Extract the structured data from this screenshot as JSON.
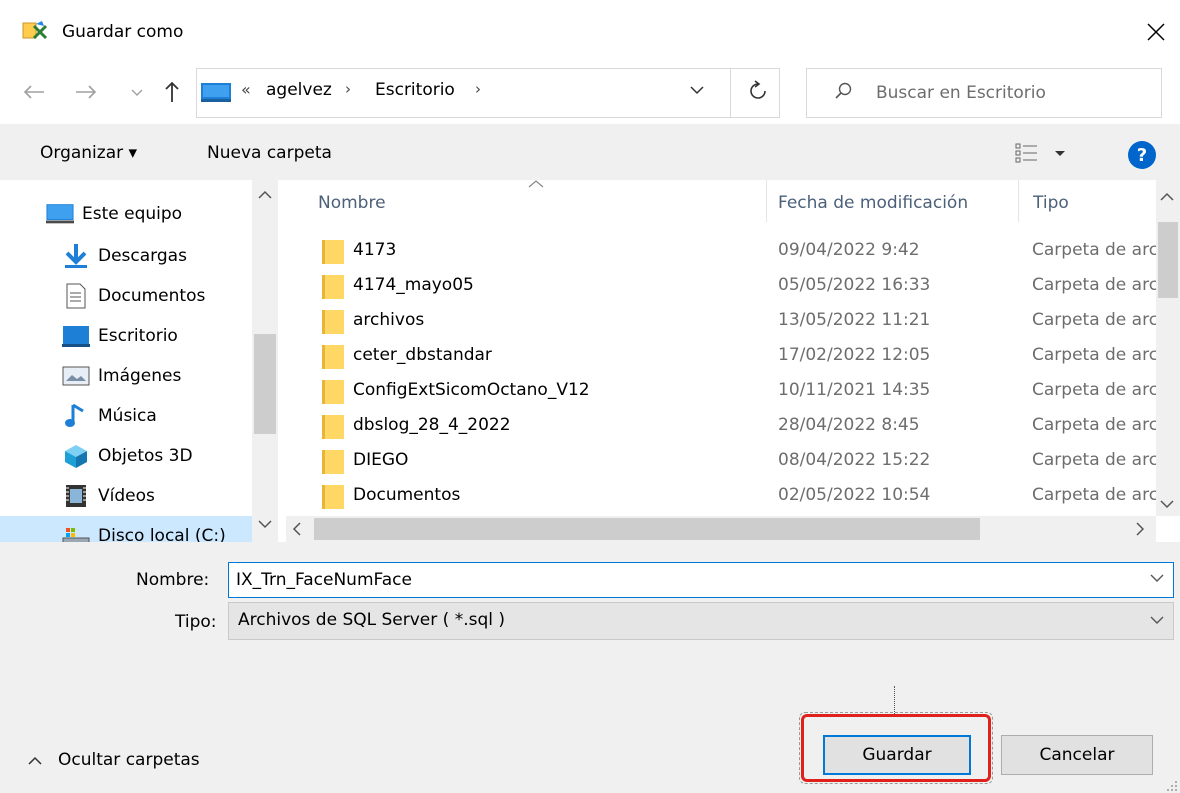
{
  "window": {
    "title": "Guardar como"
  },
  "address": {
    "overflow": "«",
    "crumbs": [
      "agelvez",
      "Escritorio"
    ],
    "separator": "›"
  },
  "search": {
    "placeholder": "Buscar en Escritorio"
  },
  "toolbar": {
    "organize": "Organizar ▾",
    "new_folder": "Nueva carpeta",
    "help": "?"
  },
  "nav_pane": {
    "items": [
      {
        "label": "Este equipo",
        "icon": "pc-icon"
      },
      {
        "label": "Descargas",
        "icon": "download-icon"
      },
      {
        "label": "Documentos",
        "icon": "document-icon"
      },
      {
        "label": "Escritorio",
        "icon": "desktop-icon"
      },
      {
        "label": "Imágenes",
        "icon": "image-icon"
      },
      {
        "label": "Música",
        "icon": "music-icon"
      },
      {
        "label": "Objetos 3D",
        "icon": "cube-icon"
      },
      {
        "label": "Vídeos",
        "icon": "video-icon"
      },
      {
        "label": "Disco local (C:)",
        "icon": "drive-icon"
      }
    ]
  },
  "columns": {
    "name": "Nombre",
    "date": "Fecha de modificación",
    "type": "Tipo"
  },
  "files": [
    {
      "name": "4173",
      "date": "09/04/2022 9:42",
      "type": "Carpeta de archivos"
    },
    {
      "name": "4174_mayo05",
      "date": "05/05/2022 16:33",
      "type": "Carpeta de archivos"
    },
    {
      "name": "archivos",
      "date": "13/05/2022 11:21",
      "type": "Carpeta de archivos"
    },
    {
      "name": "ceter_dbstandar",
      "date": "17/02/2022 12:05",
      "type": "Carpeta de archivos"
    },
    {
      "name": "ConfigExtSicomOctano_V12",
      "date": "10/11/2021 14:35",
      "type": "Carpeta de archivos"
    },
    {
      "name": "dbslog_28_4_2022",
      "date": "28/04/2022 8:45",
      "type": "Carpeta de archivos"
    },
    {
      "name": "DIEGO",
      "date": "08/04/2022 15:22",
      "type": "Carpeta de archivos"
    },
    {
      "name": "Documentos",
      "date": "02/05/2022 10:54",
      "type": "Carpeta de archivos"
    }
  ],
  "form": {
    "name_label": "Nombre:",
    "name_value": "IX_Trn_FaceNumFace",
    "type_label": "Tipo:",
    "type_value": "Archivos de SQL Server ( *.sql )"
  },
  "footer": {
    "hide_folders": "Ocultar carpetas",
    "save": "Guardar",
    "cancel": "Cancelar"
  },
  "colors": {
    "accent": "#0078d7",
    "highlight": "#e0201b",
    "folder": "#ffd764"
  }
}
